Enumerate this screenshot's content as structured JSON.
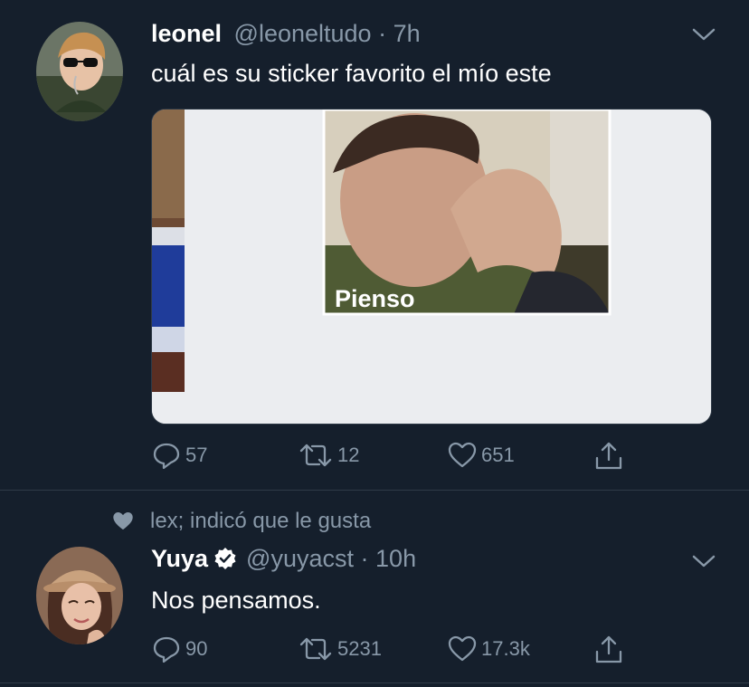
{
  "tweet1": {
    "display_name": "leonel",
    "handle": "@leoneltudo",
    "separator": "·",
    "time": "7h",
    "text": "cuál es su sticker favorito el mío este",
    "sticker_caption": "Pienso",
    "replies": "57",
    "retweets": "12",
    "likes": "651"
  },
  "social_context": {
    "text": "lex; indicó que le gusta"
  },
  "tweet2": {
    "display_name": "Yuya",
    "handle": "@yuyacst",
    "separator": "·",
    "time": "10h",
    "text": "Nos pensamos.",
    "replies": "90",
    "retweets": "5231",
    "likes": "17.3k"
  },
  "colors": {
    "background": "#151f2c",
    "secondary_text": "#8898a8",
    "divider": "#2f3a47",
    "verified_badge": "#ffffff"
  }
}
